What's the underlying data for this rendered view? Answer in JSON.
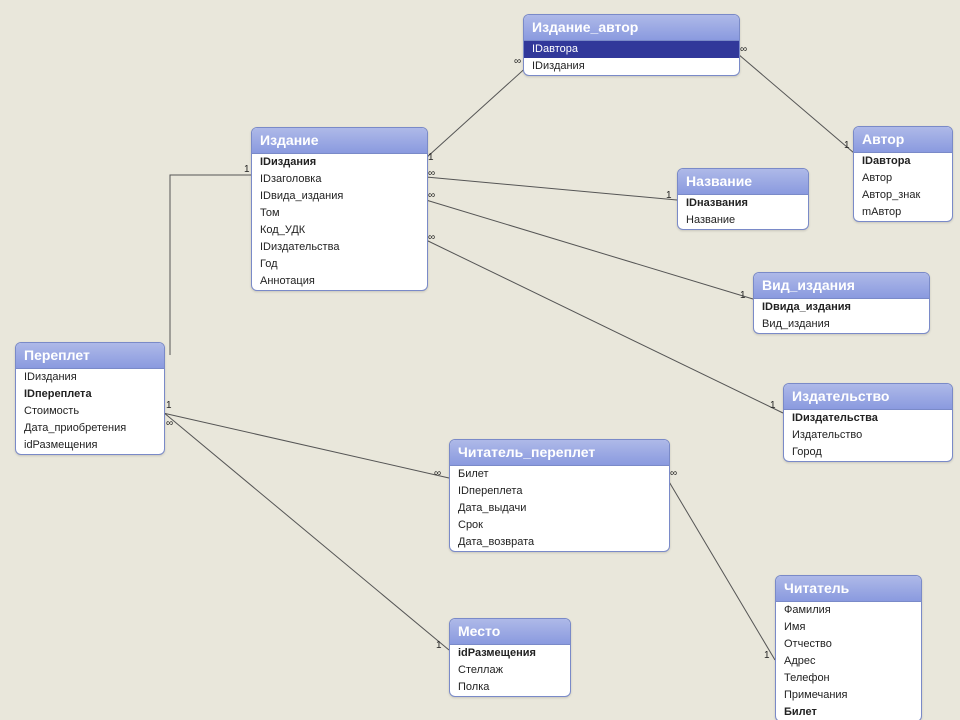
{
  "entities": {
    "pereplet": {
      "title": "Переплет",
      "fields": [
        "IDиздания",
        "IDпереплета",
        "Стоимость",
        "Дата_приобретения",
        "idРазмещения"
      ]
    },
    "izdanie": {
      "title": "Издание",
      "fields": [
        "IDиздания",
        "IDзаголовка",
        "IDвида_издания",
        "Том",
        "Код_УДК",
        "IDиздательства",
        "Год",
        "Аннотация"
      ]
    },
    "izdanie_avtor": {
      "title": "Издание_автор",
      "fields": [
        "IDавтора",
        "IDиздания"
      ]
    },
    "avtor": {
      "title": "Автор",
      "fields": [
        "IDавтора",
        "Автор",
        "Автор_знак",
        "mАвтор"
      ]
    },
    "nazvanie": {
      "title": "Название",
      "fields": [
        "IDназвания",
        "Название"
      ]
    },
    "vid_izdaniya": {
      "title": "Вид_издания",
      "fields": [
        "IDвида_издания",
        "Вид_издания"
      ]
    },
    "izdatelstvo": {
      "title": "Издательство",
      "fields": [
        "IDиздательства",
        "Издательство",
        "Город"
      ]
    },
    "chitatel_pereplet": {
      "title": "Читатель_переплет",
      "fields": [
        "Билет",
        "IDпереплета",
        "Дата_выдачи",
        "Срок",
        "Дата_возврата"
      ]
    },
    "mesto": {
      "title": "Место",
      "fields": [
        "idРазмещения",
        "Стеллаж",
        "Полка"
      ]
    },
    "chitatel": {
      "title": "Читатель",
      "fields": [
        "Фамилия",
        "Имя",
        "Отчество",
        "Адрес",
        "Телефон",
        "Примечания",
        "Билет"
      ]
    }
  },
  "relationships": [
    {
      "from": "izdanie",
      "to": "pereplet",
      "from_card": "1",
      "to_card": "∞"
    },
    {
      "from": "izdanie",
      "to": "izdanie_avtor",
      "from_card": "1",
      "to_card": "∞"
    },
    {
      "from": "izdanie",
      "to": "nazvanie",
      "from_card": "∞",
      "to_card": "1"
    },
    {
      "from": "izdanie",
      "to": "vid_izdaniya",
      "from_card": "∞",
      "to_card": "1"
    },
    {
      "from": "izdanie",
      "to": "izdatelstvo",
      "from_card": "∞",
      "to_card": "1"
    },
    {
      "from": "izdanie_avtor",
      "to": "avtor",
      "from_card": "∞",
      "to_card": "1"
    },
    {
      "from": "pereplet",
      "to": "chitatel_pereplet",
      "from_card": "1",
      "to_card": "∞"
    },
    {
      "from": "pereplet",
      "to": "mesto",
      "from_card": "∞",
      "to_card": "1"
    },
    {
      "from": "chitatel_pereplet",
      "to": "chitatel",
      "from_card": "∞",
      "to_card": "1"
    }
  ]
}
